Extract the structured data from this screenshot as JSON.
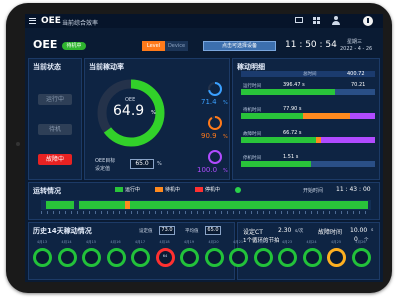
{
  "header": {
    "title": "OEE",
    "subtitle": "当前综合效率",
    "icons": [
      "desktop-icon",
      "grid-icon",
      "user-icon",
      "power-icon"
    ],
    "icon_labels": [
      "",
      "",
      "",
      ""
    ]
  },
  "toolbar": {
    "oee_label": "OEE",
    "status_pill": "待机中",
    "tab_active": "Level",
    "tab_inactive": "Device",
    "device_selector": "点击可选择设备",
    "time": "11 : 50 : 54",
    "weekday": "星期三",
    "date": "2022 - 4 - 26"
  },
  "status_panel": {
    "title": "当前状态",
    "buttons": [
      "运行中",
      "待机",
      "故障中"
    ]
  },
  "efficiency_panel": {
    "title": "当前稼动率",
    "donut_label": "OEE",
    "donut_value": "64.9",
    "donut_unit": "%",
    "donut_fraction": 0.649,
    "target_label": "OEE目标",
    "target_label2": "设定值",
    "target_value": "65.0",
    "target_unit": "%",
    "metrics": [
      {
        "value": "71.4",
        "unit": "%",
        "color": "#3aa0ff",
        "fraction": 0.714
      },
      {
        "value": "90.9",
        "unit": "%",
        "color": "#ff7a1a",
        "fraction": 0.909
      },
      {
        "value": "100.0",
        "unit": "%",
        "color": "#b04bff",
        "fraction": 1.0
      }
    ]
  },
  "detail_panel": {
    "title": "稼动明细",
    "header_row": {
      "label": "总时间",
      "value": "400.72"
    },
    "rows": [
      {
        "label": "运行时间",
        "value": "396.47",
        "unit": "s",
        "pct": "70.21",
        "fractions": [
          0.702,
          0.0,
          0.0
        ]
      },
      {
        "label": "待机时间",
        "value": "77.90",
        "unit": "s",
        "pct": "",
        "fractions": [
          0.46,
          0.35,
          0.19
        ]
      },
      {
        "label": "故障时间",
        "value": "66.72",
        "unit": "s",
        "pct": "",
        "fractions": [
          0.56,
          0.04,
          0.4
        ]
      },
      {
        "label": "停机时间",
        "value": "1.51",
        "unit": "s",
        "pct": "",
        "fractions": [
          0.52,
          0.0,
          0.0
        ]
      }
    ]
  },
  "timeline": {
    "title": "运转情况",
    "legend": [
      {
        "label": "运行中",
        "color": "#29c43a"
      },
      {
        "label": "待机中",
        "color": "#ff8a1e"
      },
      {
        "label": "停机中",
        "color": "#ff3030"
      },
      {
        "label": "",
        "color": "#2ad14a"
      }
    ],
    "time_label": "开始时间",
    "time_value": "11 : 43 : 00"
  },
  "history": {
    "title": "历史14天稼动情况",
    "field1_label": "设定值",
    "field1_value": "73.0",
    "field2_label": "平均值",
    "field2_value": "65.0",
    "days": [
      {
        "label": "4月13",
        "value": "",
        "color": "#22c23a"
      },
      {
        "label": "4月14",
        "value": "",
        "color": "#22c23a"
      },
      {
        "label": "4月15",
        "value": "",
        "color": "#22c23a"
      },
      {
        "label": "4月16",
        "value": "",
        "color": "#22c23a"
      },
      {
        "label": "4月17",
        "value": "",
        "color": "#22c23a"
      },
      {
        "label": "4月18",
        "value": "64",
        "color": "#ff3030"
      },
      {
        "label": "4月19",
        "value": "",
        "color": "#22c23a"
      },
      {
        "label": "4月20",
        "value": "",
        "color": "#22c23a"
      },
      {
        "label": "4月21",
        "value": "",
        "color": "#22c23a"
      },
      {
        "label": "4月22",
        "value": "",
        "color": "#22c23a"
      },
      {
        "label": "4月23",
        "value": "",
        "color": "#22c23a"
      },
      {
        "label": "4月24",
        "value": "",
        "color": "#22c23a"
      },
      {
        "label": "4月25",
        "value": "",
        "color": "#ffb020"
      },
      {
        "label": "4月26",
        "value": "",
        "color": "#22c23a"
      }
    ]
  },
  "cycle": {
    "ct_label": "设定CT",
    "ct_value": "2.30",
    "ct_unit": "s/次",
    "fault_label": "故障时间",
    "fault_value": "10.00",
    "fault_unit": "s",
    "line2_label": "1个循环的节拍",
    "line2_value": "0",
    "line2_unit": "个"
  }
}
